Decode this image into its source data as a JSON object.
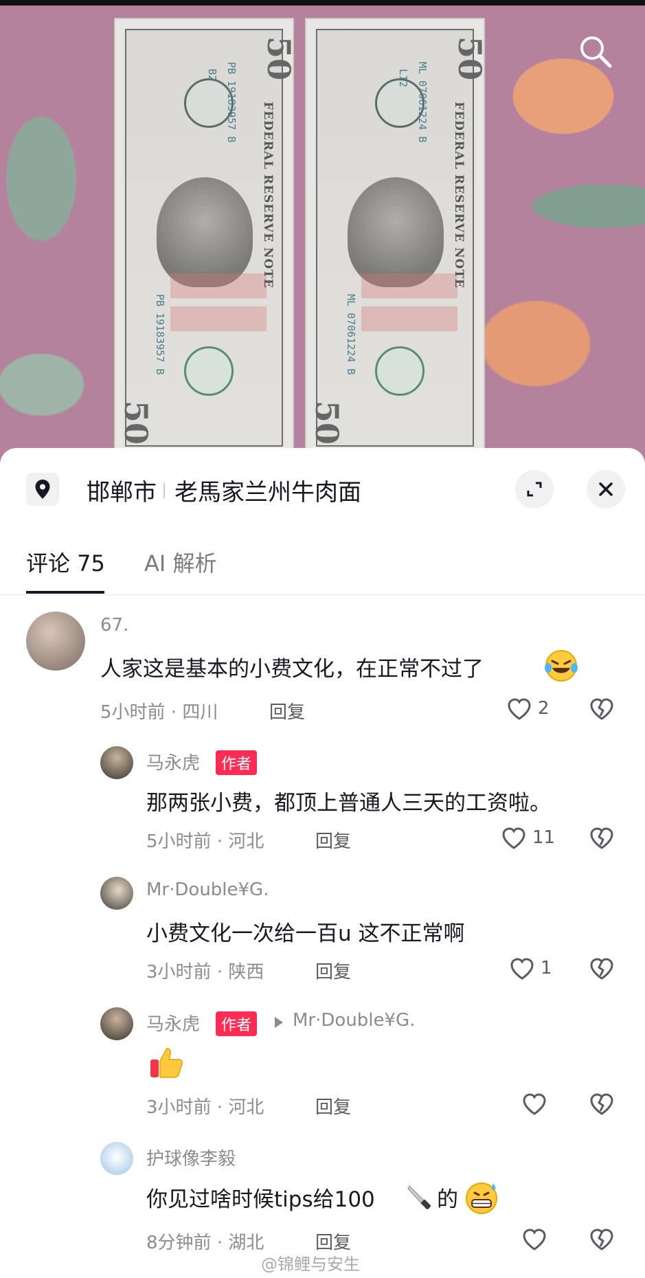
{
  "photo": {
    "bill_left": {
      "denomination": "50",
      "serial": "PB 19183957 B",
      "plate": "B2",
      "words": "FEDERAL RESERVE NOTE"
    },
    "bill_right": {
      "denomination": "50",
      "serial": "ML 07061224 B",
      "plate": "L12",
      "words": "FEDERAL RESERVE NOTE"
    }
  },
  "location": {
    "city": "邯郸市",
    "place": "老馬家兰州牛肉面"
  },
  "tabs": [
    {
      "label": "评论 75"
    },
    {
      "label": "AI 解析"
    }
  ],
  "comments": [
    {
      "user": "67.",
      "text": "人家这是基本的小费文化，在正常不过了",
      "time": "5小时前 · 四川",
      "reply": "回复",
      "likes": "2"
    },
    {
      "user": "马永虎",
      "badge": "作者",
      "text": "那两张小费，都顶上普通人三天的工资啦。",
      "time": "5小时前 · 河北",
      "reply": "回复",
      "likes": "11"
    },
    {
      "user": "Mr·Double¥G.",
      "text": "小费文化一次给一百u 这不正常啊",
      "time": "3小时前 · 陕西",
      "reply": "回复",
      "likes": "1"
    },
    {
      "user": "马永虎",
      "badge": "作者",
      "reply_to": "Mr·Double¥G.",
      "time": "3小时前 · 河北",
      "reply": "回复",
      "likes": ""
    },
    {
      "user": "护球像李毅",
      "text_a": "你见过啥时候tips给100",
      "text_b": "的",
      "time": "8分钟前 · 湖北",
      "reply": "回复",
      "likes": ""
    }
  ],
  "watermark": "@锦鲤与安生",
  "icons": {
    "search": "search-icon",
    "location": "location-pin-icon",
    "expand": "expand-icon",
    "close": "close-icon",
    "like": "heart-icon",
    "dislike": "broken-heart-icon"
  },
  "colors": {
    "accent_badge": "#fe2c55",
    "text_primary": "#161823",
    "text_secondary": "#8a8b91"
  }
}
